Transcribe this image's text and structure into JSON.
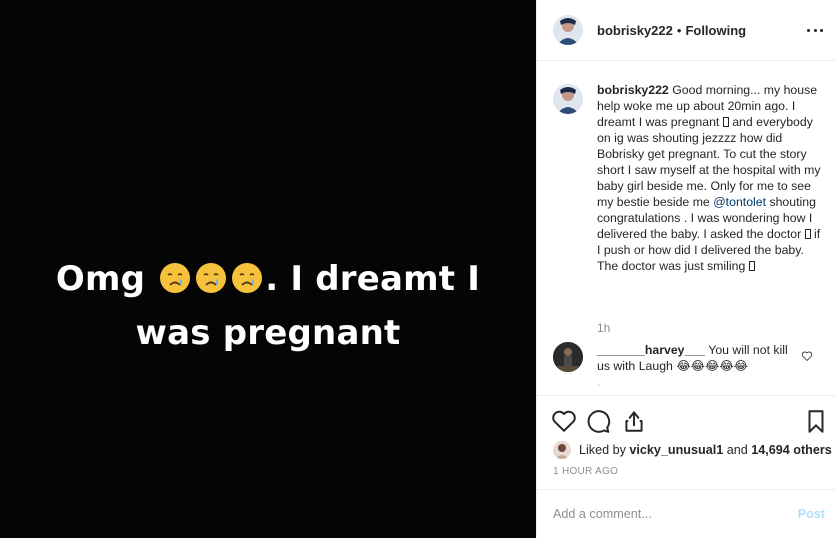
{
  "media": {
    "line1_start": "Omg",
    "line1_end": ". I dreamt I",
    "line2": "was pregnant",
    "emoji_icons": [
      "crying-face-icon",
      "crying-face-icon",
      "crying-face-icon"
    ]
  },
  "header": {
    "username": "bobrisky222",
    "separator": "•",
    "follow_status": "Following"
  },
  "caption": {
    "username": "bobrisky222",
    "text_1": " Good morning... my house help woke me up about 20min ago. I dreamt I was pregnant ",
    "text_2": " and everybody on ig was shouting jezzzz how did Bobrisky get pregnant. To cut the story short I saw myself at the hospital with my baby girl beside me. Only for me to see my bestie beside me ",
    "mention": "@tontolet",
    "text_3": " shouting congratulations . I was wondering how I delivered the baby. I asked the doctor ",
    "text_4": " if I push or how did I delivered the baby. The doctor was just smiling ",
    "time": "1h"
  },
  "comment": {
    "username": "_______harvey___",
    "text": " You will not kill us with Laugh ",
    "emojis": "😂😂😂😂😂"
  },
  "likes": {
    "prefix": "Liked by ",
    "liker": "vicky_unusual1",
    "middle": " and ",
    "others": "14,694 others"
  },
  "time_ago": "1 HOUR AGO",
  "add_comment": {
    "placeholder": "Add a comment...",
    "post_label": "Post"
  },
  "colors": {
    "media_bg": "#050505",
    "mention": "#00376b",
    "muted": "#8e8e8e",
    "post_button": "#b2dffc"
  }
}
